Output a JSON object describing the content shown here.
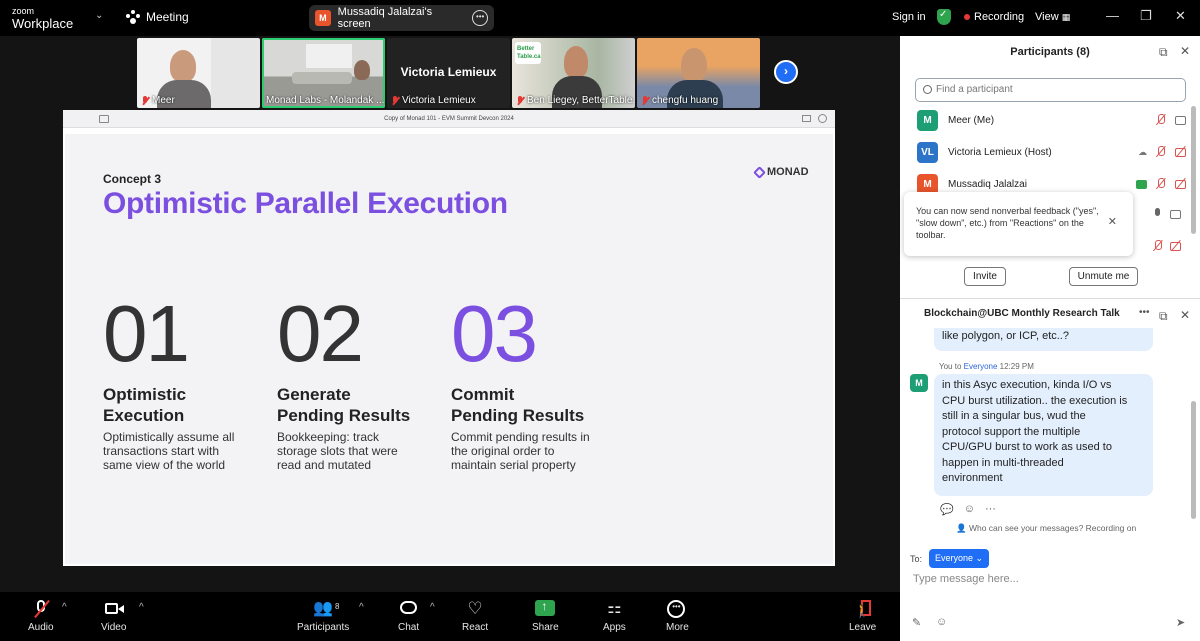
{
  "topbar": {
    "brand_top": "zoom",
    "brand_bottom": "Workplace",
    "meeting_label": "Meeting",
    "share_badge": "M",
    "share_title": "Mussadiq Jalalzai's screen",
    "sign_in": "Sign in",
    "recording": "Recording",
    "view": "View"
  },
  "thumbnails": [
    {
      "name": "Meer",
      "muted": true
    },
    {
      "name": "Monad Labs - Molandak ...",
      "muted": false
    },
    {
      "name": "Victoria Lemieux",
      "big_name": "Victoria Lemieux",
      "muted": true
    },
    {
      "name": "Ben Liegey, BetterTable...",
      "logo_text": "Better Table.ca",
      "muted": true
    },
    {
      "name": "chengfu huang",
      "muted": true
    }
  ],
  "shared_screen": {
    "window_title": "Copy of Monad 101 - EVM Summit Devcon 2024",
    "slide": {
      "concept": "Concept 3",
      "title": "Optimistic Parallel Execution",
      "logo": "MONAD",
      "columns": [
        {
          "num": "01",
          "heading_1": "Optimistic",
          "heading_2": "Execution",
          "body": "Optimistically assume all transactions start with same view of the world"
        },
        {
          "num": "02",
          "heading_1": "Generate",
          "heading_2": "Pending Results",
          "body": "Bookkeeping: track storage slots that were read and mutated"
        },
        {
          "num": "03",
          "heading_1": "Commit",
          "heading_2": "Pending Results",
          "body": "Commit pending results in the original order to maintain serial property"
        }
      ]
    }
  },
  "toolbar": {
    "audio": "Audio",
    "video": "Video",
    "participants": "Participants",
    "participants_count": "8",
    "chat": "Chat",
    "react": "React",
    "share": "Share",
    "apps": "Apps",
    "more": "More",
    "leave": "Leave"
  },
  "participants_panel": {
    "title": "Participants (8)",
    "search_placeholder": "Find a participant",
    "rows": [
      {
        "initials": "M",
        "name": "Meer (Me)",
        "color": "#1e9e74"
      },
      {
        "initials": "VL",
        "name": "Victoria Lemieux (Host)",
        "color": "#2b74c7"
      },
      {
        "initials": "M",
        "name": "Mussadiq Jalalzai",
        "color": "#e8552d"
      }
    ],
    "tooltip": "You can now send nonverbal feedback (\"yes\", \"slow down\", etc.) from \"Reactions\" on the toolbar.",
    "invite": "Invite",
    "unmute": "Unmute me"
  },
  "chat_panel": {
    "title": "Blockchain@UBC Monthly Research Talk",
    "prev_message_tail": "like polygon, or ICP, etc..?",
    "meta_you": "You to ",
    "meta_who": "Everyone",
    "meta_time": " 12:29 PM",
    "sender_initial": "M",
    "message_lines": [
      "in this Asyc execution, kinda I/O vs",
      "CPU burst utilization.. the execution is",
      "still in a singular bus, wud the",
      "protocol support the multiple",
      "CPU/GPU burst to work as used to",
      "happen in multi-threaded",
      "environment"
    ],
    "who_can_see": "Who can see your messages? Recording on",
    "to_label": "To:",
    "to_value": "Everyone",
    "input_placeholder": "Type message here..."
  }
}
